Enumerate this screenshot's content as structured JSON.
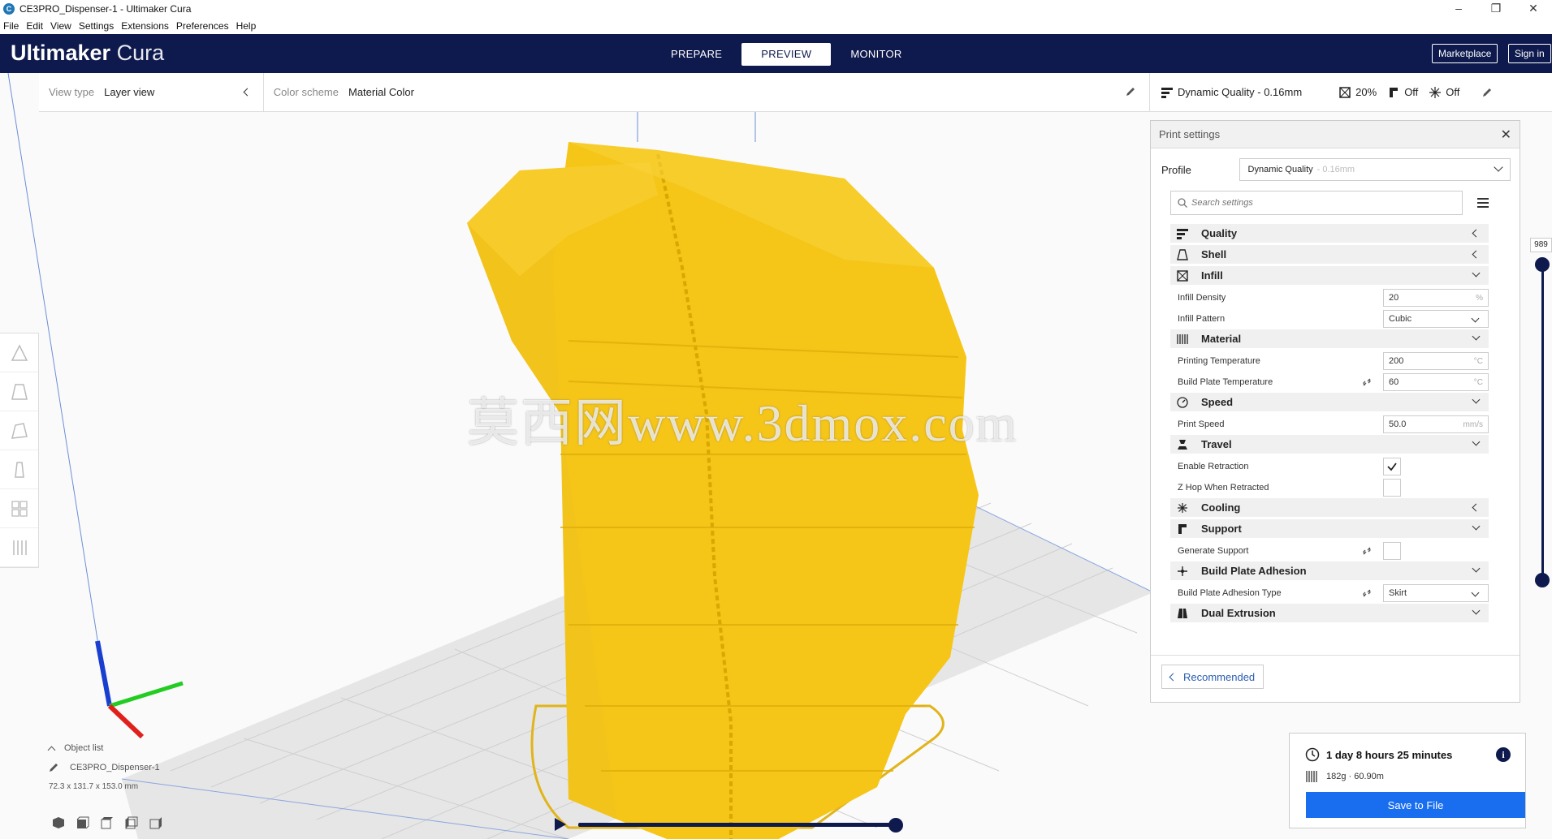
{
  "window": {
    "title": "CE3PRO_Dispenser-1 - Ultimaker Cura",
    "app_icon_letter": "C",
    "controls": [
      "–",
      "❐",
      "✕"
    ]
  },
  "menu": [
    "File",
    "Edit",
    "View",
    "Settings",
    "Extensions",
    "Preferences",
    "Help"
  ],
  "header": {
    "brand_bold": "Ultimaker",
    "brand_light": " Cura",
    "stages": [
      {
        "label": "PREPARE",
        "active": false
      },
      {
        "label": "PREVIEW",
        "active": true
      },
      {
        "label": "MONITOR",
        "active": false
      }
    ],
    "marketplace_label": "Marketplace",
    "signin_label": "Sign in"
  },
  "viewbar": {
    "view_type_label": "View type",
    "view_type_value": "Layer view",
    "color_scheme_label": "Color scheme",
    "color_scheme_value": "Material Color"
  },
  "setup_summary": {
    "profile": "Dynamic Quality - 0.16mm",
    "infill": "20%",
    "support": "Off",
    "adhesion": "Off"
  },
  "print_settings": {
    "title": "Print settings",
    "profile_label": "Profile",
    "profile_value": "Dynamic Quality",
    "profile_suffix": "- 0.16mm",
    "search_placeholder": "Search settings",
    "recommended_label": "Recommended",
    "sections": [
      {
        "name": "Quality",
        "icon": "quality-icon",
        "expanded": false,
        "settings": []
      },
      {
        "name": "Shell",
        "icon": "shell-icon",
        "expanded": false,
        "settings": []
      },
      {
        "name": "Infill",
        "icon": "infill-icon",
        "expanded": true,
        "settings": [
          {
            "label": "Infill Density",
            "value": "20",
            "unit": "%"
          },
          {
            "label": "Infill Pattern",
            "value": "Cubic",
            "kind": "dropdown"
          }
        ]
      },
      {
        "name": "Material",
        "icon": "material-icon",
        "expanded": true,
        "settings": [
          {
            "label": "Printing Temperature",
            "value": "200",
            "unit": "°C"
          },
          {
            "label": "Build Plate Temperature",
            "value": "60",
            "unit": "°C",
            "linked": true
          }
        ]
      },
      {
        "name": "Speed",
        "icon": "speed-icon",
        "expanded": true,
        "settings": [
          {
            "label": "Print Speed",
            "value": "50.0",
            "unit": "mm/s"
          }
        ]
      },
      {
        "name": "Travel",
        "icon": "travel-icon",
        "expanded": true,
        "settings": [
          {
            "label": "Enable Retraction",
            "kind": "checkbox",
            "checked": true
          },
          {
            "label": "Z Hop When Retracted",
            "kind": "checkbox",
            "checked": false
          }
        ]
      },
      {
        "name": "Cooling",
        "icon": "cooling-icon",
        "expanded": false,
        "settings": []
      },
      {
        "name": "Support",
        "icon": "support-icon",
        "expanded": true,
        "settings": [
          {
            "label": "Generate Support",
            "kind": "checkbox",
            "checked": false,
            "linked": true
          }
        ]
      },
      {
        "name": "Build Plate Adhesion",
        "icon": "adhesion-icon",
        "expanded": true,
        "settings": [
          {
            "label": "Build Plate Adhesion Type",
            "value": "Skirt",
            "kind": "dropdown",
            "linked": true
          }
        ]
      },
      {
        "name": "Dual Extrusion",
        "icon": "dual-extrusion-icon",
        "expanded": true,
        "settings": []
      }
    ]
  },
  "layer_slider": {
    "current_layer": "989"
  },
  "object": {
    "list_label": "Object list",
    "name": "CE3PRO_Dispenser-1",
    "dimensions": "72.3 x 131.7 x 153.0 mm"
  },
  "output": {
    "print_time": "1 day 8 hours 25 minutes",
    "material": "182g · 60.90m",
    "save_label": "Save to File"
  },
  "watermark": "莫西网www.3dmox.com",
  "colors": {
    "header_bg": "#0e1a4d",
    "model_fill": "#f5c518",
    "primary_button": "#196ef0"
  }
}
